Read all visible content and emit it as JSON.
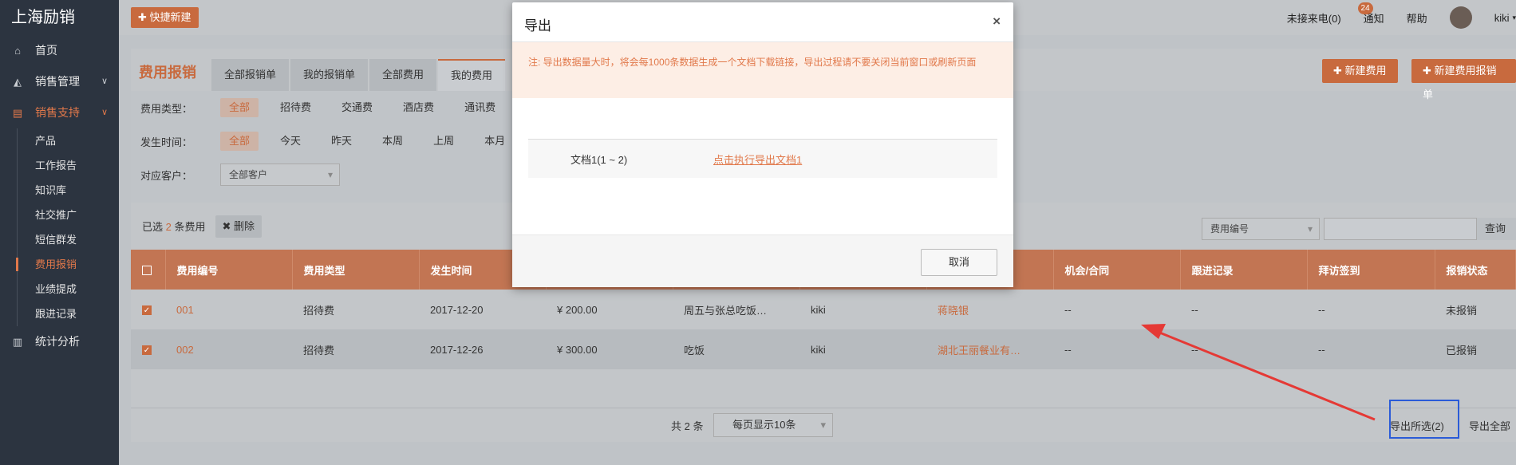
{
  "brand": "上海励销",
  "sidebar": {
    "items": [
      {
        "label": "首页",
        "icon": "home-icon"
      },
      {
        "label": "销售管理",
        "icon": "area-chart-icon"
      },
      {
        "label": "销售支持",
        "icon": "file-icon"
      },
      {
        "label": "统计分析",
        "icon": "bar-chart-icon"
      }
    ],
    "sub_items": [
      "产品",
      "工作报告",
      "知识库",
      "社交推广",
      "短信群发",
      "费用报销",
      "业绩提成",
      "跟进记录"
    ],
    "active_item": "销售支持",
    "active_sub": "费用报销"
  },
  "topbar": {
    "quick_new": "快捷新建",
    "missed_calls": "未接来电(0)",
    "notify": "通知",
    "notify_count": "24",
    "help": "帮助",
    "user": "kiki"
  },
  "page": {
    "title": "费用报销",
    "tabs": [
      "全部报销单",
      "我的报销单",
      "全部费用",
      "我的费用"
    ],
    "active_tab": "我的费用",
    "btn_new_expense": "新建费用",
    "btn_new_report": "新建费用报销单"
  },
  "filters": {
    "type_label": "费用类型：",
    "type_options": [
      "全部",
      "招待费",
      "交通费",
      "酒店费",
      "通讯费"
    ],
    "time_label": "发生时间：",
    "time_options": [
      "全部",
      "今天",
      "昨天",
      "本周",
      "上周",
      "本月"
    ],
    "customer_label": "对应客户：",
    "customer_value": "全部客户"
  },
  "toolbar": {
    "selected_prefix": "已选",
    "selected_count": "2",
    "selected_suffix": "条费用",
    "delete": "删除",
    "search_field": "费用编号",
    "search_btn": "查询"
  },
  "table": {
    "headers": [
      "费用编号",
      "费用类型",
      "发生时间",
      "",
      "",
      "",
      "",
      "机会/合同",
      "跟进记录",
      "拜访签到",
      "报销状态"
    ],
    "rows": [
      {
        "id": "001",
        "type": "招待费",
        "date": "2017-12-20",
        "amount": "¥ 200.00",
        "desc": "周五与张总吃饭…",
        "owner": "kiki",
        "customer": "蒋晓银",
        "opp": "--",
        "follow": "--",
        "visit": "--",
        "status": "未报销"
      },
      {
        "id": "002",
        "type": "招待费",
        "date": "2017-12-26",
        "amount": "¥ 300.00",
        "desc": "吃饭",
        "owner": "kiki",
        "customer": "湖北王丽餐业有…",
        "opp": "--",
        "follow": "--",
        "visit": "--",
        "status": "已报销"
      }
    ]
  },
  "pager": {
    "total": "共 2 条",
    "page_size": "每页显示10条",
    "export_selected": "导出所选(2)",
    "export_all": "导出全部"
  },
  "modal": {
    "title": "导出",
    "note": "注: 导出数据量大时，将会每1000条数据生成一个文档下载链接，导出过程请不要关闭当前窗口或刷新页面",
    "doc_name": "文档1(1 ~ 2)",
    "doc_link": "点击执行导出文档1",
    "cancel": "取消"
  },
  "colors": {
    "accent": "#c86a3e",
    "highlight_box": "#2b5bd7",
    "arrow": "#e53935"
  }
}
